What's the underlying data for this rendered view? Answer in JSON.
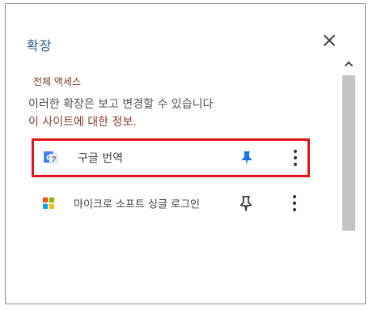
{
  "panel": {
    "title": "확장",
    "close_icon": "close-icon"
  },
  "section": {
    "title": "전체 액세스",
    "description": "이러한 확장은 보고 변경할 수 있습니다",
    "link_text": "이 사이트에 대한 정보."
  },
  "extensions": [
    {
      "name": "구글 번역",
      "icon": "google-translate-icon",
      "pinned": true,
      "highlighted": true,
      "pin_color": "#1a73e8"
    },
    {
      "name": "마이크로 소프트 싱글 로그인",
      "icon": "microsoft-logo-icon",
      "pinned": false,
      "highlighted": false,
      "pin_color": "#3c3c3c"
    }
  ],
  "colors": {
    "title": "#2b5c8f",
    "section_title": "#7a3b2a",
    "link": "#8a3b33",
    "highlight_border": "#e2141c"
  }
}
